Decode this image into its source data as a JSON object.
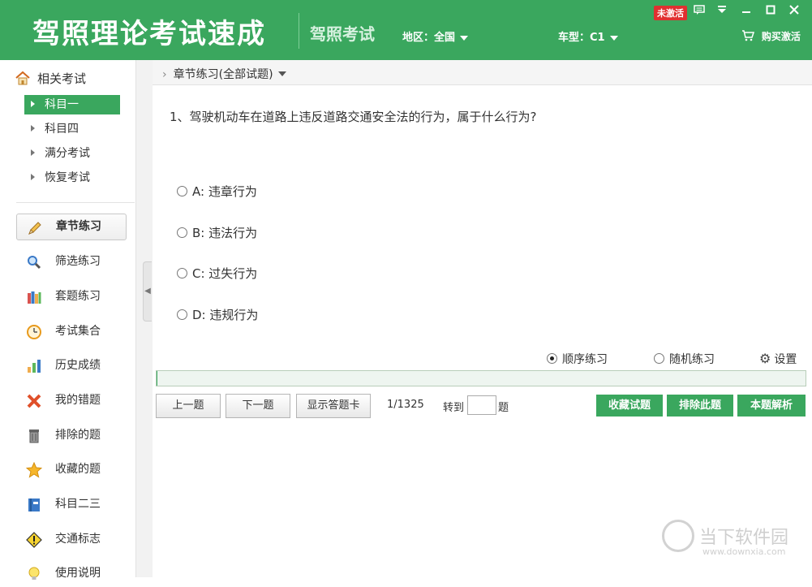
{
  "header": {
    "app_title": "驾照理论考试速成",
    "subtitle": "驾照考试",
    "region_label": "地区：全国",
    "car_type_label": "车型：C1",
    "buy_label": "购买激活",
    "status_badge": "未激活",
    "window_controls": [
      "message-icon",
      "menu-icon",
      "minimize-icon",
      "maximize-icon",
      "close-icon"
    ],
    "accent_color": "#3aa75e"
  },
  "sidebar": {
    "related_label": "相关考试",
    "subjects": [
      {
        "label": "科目一",
        "active": true
      },
      {
        "label": "科目四",
        "active": false
      },
      {
        "label": "满分考试",
        "active": false
      },
      {
        "label": "恢复考试",
        "active": false
      }
    ],
    "nav": [
      {
        "label": "章节练习",
        "icon": "pencil-icon",
        "active": true
      },
      {
        "label": "筛选练习",
        "icon": "magnifier-icon"
      },
      {
        "label": "套题练习",
        "icon": "books-icon"
      },
      {
        "label": "考试集合",
        "icon": "clock-icon"
      },
      {
        "label": "历史成绩",
        "icon": "bar-chart-icon"
      },
      {
        "label": "我的错题",
        "icon": "cross-icon"
      },
      {
        "label": "排除的题",
        "icon": "trash-icon"
      },
      {
        "label": "收藏的题",
        "icon": "star-icon"
      },
      {
        "label": "科目二三",
        "icon": "book-icon"
      },
      {
        "label": "交通标志",
        "icon": "warning-icon"
      },
      {
        "label": "使用说明",
        "icon": "bulb-icon"
      }
    ]
  },
  "main": {
    "breadcrumb": "章节练习(全部试题)",
    "question": "1、驾驶机动车在道路上违反道路交通安全法的行为，属于什么行为?",
    "options": [
      "A: 违章行为",
      "B: 违法行为",
      "C: 过失行为",
      "D: 违规行为"
    ],
    "mode_sequential": "顺序练习",
    "mode_random": "随机练习",
    "settings_label": "设置",
    "progress_fraction": 0.0008,
    "prev_label": "上一题",
    "next_label": "下一题",
    "answer_card_label": "显示答题卡",
    "page_count": "1/1325",
    "goto_label": "转到",
    "goto_suffix": "题",
    "favorite_label": "收藏试题",
    "exclude_label": "排除此题",
    "analysis_label": "本题解析"
  },
  "watermark": {
    "text": "当下软件园",
    "url": "www.downxia.com"
  }
}
